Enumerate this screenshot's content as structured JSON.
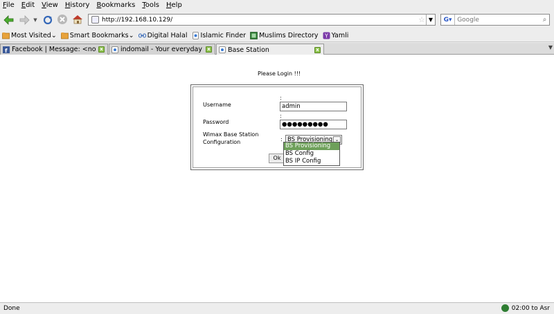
{
  "menu": [
    "File",
    "Edit",
    "View",
    "History",
    "Bookmarks",
    "Tools",
    "Help"
  ],
  "nav": {
    "url": "http://192.168.10.129/",
    "search_placeholder": "Google"
  },
  "bookmarks": [
    "Most Visited",
    "Smart Bookmarks",
    "Digital Halal",
    "Islamic Finder",
    "Muslims Directory",
    "Yamli"
  ],
  "tabs": [
    {
      "label": "Facebook | Message: <no su..."
    },
    {
      "label": "indomail - Your everyday e-..."
    },
    {
      "label": "Base Station"
    }
  ],
  "page": {
    "heading": "Please Login !!!",
    "username_label": "Username",
    "username_value": "admin",
    "password_label": "Password",
    "password_value": "●●●●●●●●●",
    "config_label_line1": "Wimax Base Station",
    "config_label_line2": "Configuration",
    "colon": ":",
    "select_value": "BS Provisioning",
    "options": [
      "BS Provisioning",
      "BS Config",
      "BS IP Config"
    ],
    "ok_label": "Ok"
  },
  "status": {
    "text": "Done",
    "clock": "02:00 to Asr"
  },
  "colors": {
    "selected_option": "#6ea05a",
    "tab_close": "#8bc24a"
  }
}
